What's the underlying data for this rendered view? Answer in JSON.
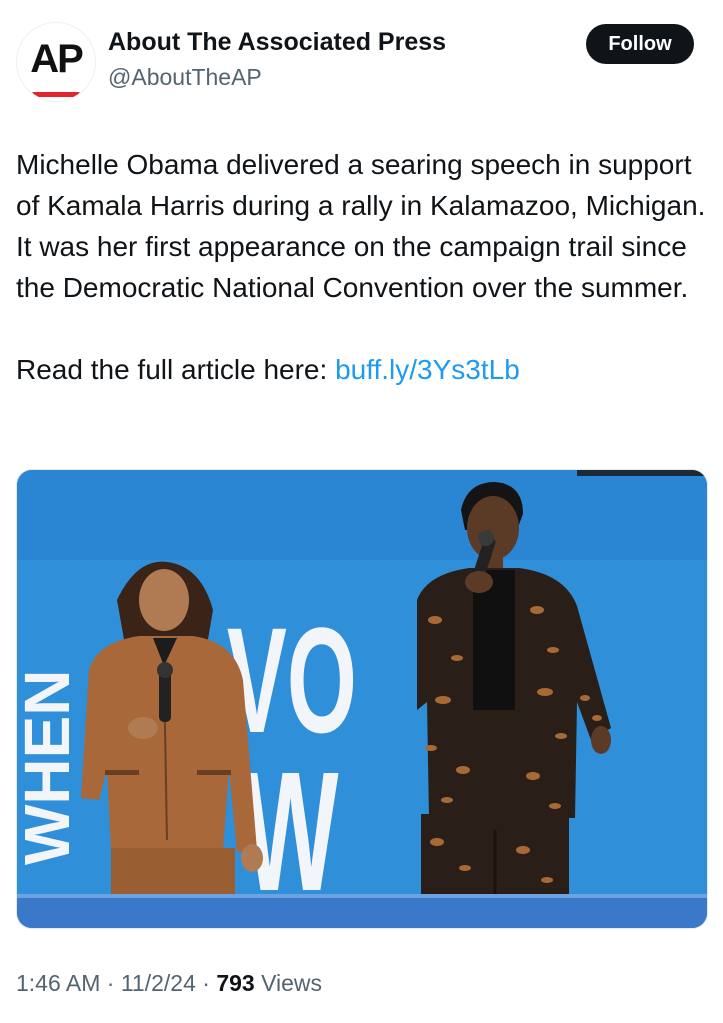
{
  "author": {
    "avatar_logo": "AP",
    "display_name": "About The Associated Press",
    "handle": "@AboutTheAP",
    "brand_colors": {
      "logo_text": "#111111",
      "logo_accent": "#e0262c"
    }
  },
  "follow_button": {
    "label": "Follow"
  },
  "tweet": {
    "text": "Michelle Obama delivered a searing speech in support of Kamala Harris during a rally in Kalamazoo, Michigan. It was her first appearance on the campaign trail since the Democratic National Convention over the summer.",
    "cta_prefix": "Read the full article here: ",
    "link_text": "buff.ly/3Ys3tLb"
  },
  "media": {
    "backdrop_text_rotated": "WHEN",
    "backdrop_text_line1": "E VO",
    "backdrop_text_line2": "E W",
    "colors": {
      "backdrop": "#2f8fd8",
      "stage": "#3a78c9",
      "tan_suit": "#a8683a"
    }
  },
  "meta": {
    "time": "1:46 AM",
    "separator": " · ",
    "date": "11/2/24",
    "views_count": "793",
    "views_label": " Views"
  },
  "colors": {
    "link": "#1d9bf0",
    "secondary_text": "#536471",
    "primary_text": "#0f1419"
  }
}
